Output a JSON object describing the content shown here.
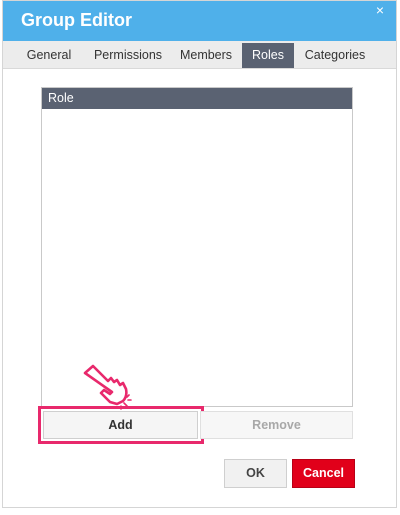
{
  "dialog": {
    "title": "Group Editor",
    "close_glyph": "×"
  },
  "tabs": [
    {
      "label": "General",
      "active": false
    },
    {
      "label": "Permissions",
      "active": false
    },
    {
      "label": "Members",
      "active": false
    },
    {
      "label": "Roles",
      "active": true
    },
    {
      "label": "Categories",
      "active": false
    }
  ],
  "roles_list": {
    "column_header": "Role",
    "rows": []
  },
  "buttons": {
    "add_label": "Add",
    "remove_label": "Remove",
    "ok_label": "OK",
    "cancel_label": "Cancel"
  },
  "annotation": {
    "icon": "pointing-hand-icon",
    "highlight_color": "#e8296c"
  },
  "colors": {
    "titlebar": "#4fb0ea",
    "active_tab": "#5a6272",
    "cancel_button": "#e1001a"
  }
}
